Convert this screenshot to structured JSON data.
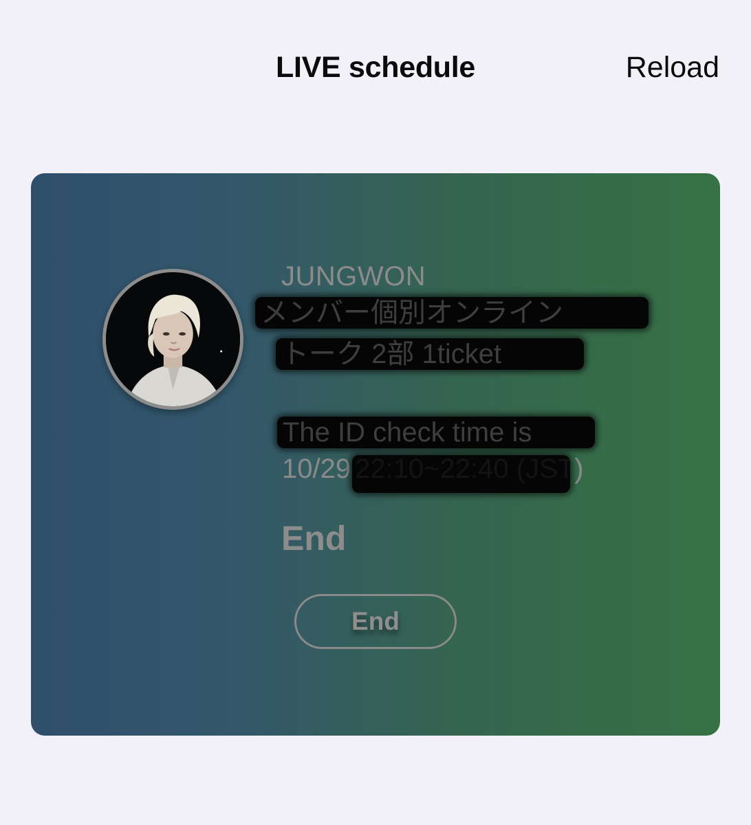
{
  "header": {
    "title": "LIVE schedule",
    "reload_label": "Reload"
  },
  "event_card": {
    "member_name": "JUNGWON",
    "title_line_1": "メンバー個別オンライン",
    "title_line_2": "トーク 2部 1ticket",
    "id_check_label": "The ID check time is",
    "date": "10/29",
    "time_range": "22:10~22:40 (JST",
    "time_range_close": ")",
    "status": "End",
    "button_label": "End",
    "colors": {
      "gradient_left": "#2f4f6d",
      "gradient_right": "#367244",
      "muted_text": "#8b8b8b"
    },
    "avatar_icon": "member-photo"
  }
}
